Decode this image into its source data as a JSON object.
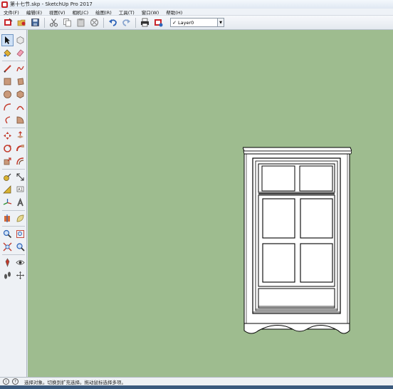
{
  "window": {
    "title": "第十七节.skp - SketchUp Pro 2017"
  },
  "menu": [
    "文件(F)",
    "编辑(E)",
    "视图(V)",
    "相机(C)",
    "绘图(R)",
    "工具(T)",
    "窗口(W)",
    "帮助(H)"
  ],
  "toolbar": {
    "layer_value": "Layer0",
    "layer_check": "✓"
  },
  "status": {
    "text": "选择对象。切换到扩充选择。拖动鼠标选择多项。",
    "icon1": "i",
    "icon2": "?"
  },
  "colors": {
    "viewport_bg": "#9ebc8f",
    "accent_red": "#c8262b"
  }
}
